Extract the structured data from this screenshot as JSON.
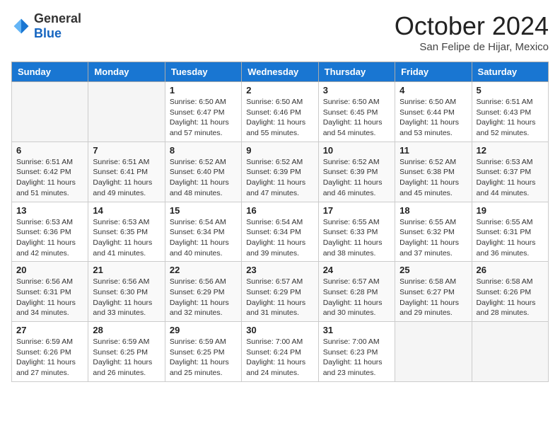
{
  "logo": {
    "general": "General",
    "blue": "Blue"
  },
  "header": {
    "month": "October 2024",
    "location": "San Felipe de Hijar, Mexico"
  },
  "weekdays": [
    "Sunday",
    "Monday",
    "Tuesday",
    "Wednesday",
    "Thursday",
    "Friday",
    "Saturday"
  ],
  "weeks": [
    [
      {
        "day": "",
        "info": ""
      },
      {
        "day": "",
        "info": ""
      },
      {
        "day": "1",
        "info": "Sunrise: 6:50 AM\nSunset: 6:47 PM\nDaylight: 11 hours and 57 minutes."
      },
      {
        "day": "2",
        "info": "Sunrise: 6:50 AM\nSunset: 6:46 PM\nDaylight: 11 hours and 55 minutes."
      },
      {
        "day": "3",
        "info": "Sunrise: 6:50 AM\nSunset: 6:45 PM\nDaylight: 11 hours and 54 minutes."
      },
      {
        "day": "4",
        "info": "Sunrise: 6:50 AM\nSunset: 6:44 PM\nDaylight: 11 hours and 53 minutes."
      },
      {
        "day": "5",
        "info": "Sunrise: 6:51 AM\nSunset: 6:43 PM\nDaylight: 11 hours and 52 minutes."
      }
    ],
    [
      {
        "day": "6",
        "info": "Sunrise: 6:51 AM\nSunset: 6:42 PM\nDaylight: 11 hours and 51 minutes."
      },
      {
        "day": "7",
        "info": "Sunrise: 6:51 AM\nSunset: 6:41 PM\nDaylight: 11 hours and 49 minutes."
      },
      {
        "day": "8",
        "info": "Sunrise: 6:52 AM\nSunset: 6:40 PM\nDaylight: 11 hours and 48 minutes."
      },
      {
        "day": "9",
        "info": "Sunrise: 6:52 AM\nSunset: 6:39 PM\nDaylight: 11 hours and 47 minutes."
      },
      {
        "day": "10",
        "info": "Sunrise: 6:52 AM\nSunset: 6:39 PM\nDaylight: 11 hours and 46 minutes."
      },
      {
        "day": "11",
        "info": "Sunrise: 6:52 AM\nSunset: 6:38 PM\nDaylight: 11 hours and 45 minutes."
      },
      {
        "day": "12",
        "info": "Sunrise: 6:53 AM\nSunset: 6:37 PM\nDaylight: 11 hours and 44 minutes."
      }
    ],
    [
      {
        "day": "13",
        "info": "Sunrise: 6:53 AM\nSunset: 6:36 PM\nDaylight: 11 hours and 42 minutes."
      },
      {
        "day": "14",
        "info": "Sunrise: 6:53 AM\nSunset: 6:35 PM\nDaylight: 11 hours and 41 minutes."
      },
      {
        "day": "15",
        "info": "Sunrise: 6:54 AM\nSunset: 6:34 PM\nDaylight: 11 hours and 40 minutes."
      },
      {
        "day": "16",
        "info": "Sunrise: 6:54 AM\nSunset: 6:34 PM\nDaylight: 11 hours and 39 minutes."
      },
      {
        "day": "17",
        "info": "Sunrise: 6:55 AM\nSunset: 6:33 PM\nDaylight: 11 hours and 38 minutes."
      },
      {
        "day": "18",
        "info": "Sunrise: 6:55 AM\nSunset: 6:32 PM\nDaylight: 11 hours and 37 minutes."
      },
      {
        "day": "19",
        "info": "Sunrise: 6:55 AM\nSunset: 6:31 PM\nDaylight: 11 hours and 36 minutes."
      }
    ],
    [
      {
        "day": "20",
        "info": "Sunrise: 6:56 AM\nSunset: 6:31 PM\nDaylight: 11 hours and 34 minutes."
      },
      {
        "day": "21",
        "info": "Sunrise: 6:56 AM\nSunset: 6:30 PM\nDaylight: 11 hours and 33 minutes."
      },
      {
        "day": "22",
        "info": "Sunrise: 6:56 AM\nSunset: 6:29 PM\nDaylight: 11 hours and 32 minutes."
      },
      {
        "day": "23",
        "info": "Sunrise: 6:57 AM\nSunset: 6:29 PM\nDaylight: 11 hours and 31 minutes."
      },
      {
        "day": "24",
        "info": "Sunrise: 6:57 AM\nSunset: 6:28 PM\nDaylight: 11 hours and 30 minutes."
      },
      {
        "day": "25",
        "info": "Sunrise: 6:58 AM\nSunset: 6:27 PM\nDaylight: 11 hours and 29 minutes."
      },
      {
        "day": "26",
        "info": "Sunrise: 6:58 AM\nSunset: 6:26 PM\nDaylight: 11 hours and 28 minutes."
      }
    ],
    [
      {
        "day": "27",
        "info": "Sunrise: 6:59 AM\nSunset: 6:26 PM\nDaylight: 11 hours and 27 minutes."
      },
      {
        "day": "28",
        "info": "Sunrise: 6:59 AM\nSunset: 6:25 PM\nDaylight: 11 hours and 26 minutes."
      },
      {
        "day": "29",
        "info": "Sunrise: 6:59 AM\nSunset: 6:25 PM\nDaylight: 11 hours and 25 minutes."
      },
      {
        "day": "30",
        "info": "Sunrise: 7:00 AM\nSunset: 6:24 PM\nDaylight: 11 hours and 24 minutes."
      },
      {
        "day": "31",
        "info": "Sunrise: 7:00 AM\nSunset: 6:23 PM\nDaylight: 11 hours and 23 minutes."
      },
      {
        "day": "",
        "info": ""
      },
      {
        "day": "",
        "info": ""
      }
    ]
  ]
}
